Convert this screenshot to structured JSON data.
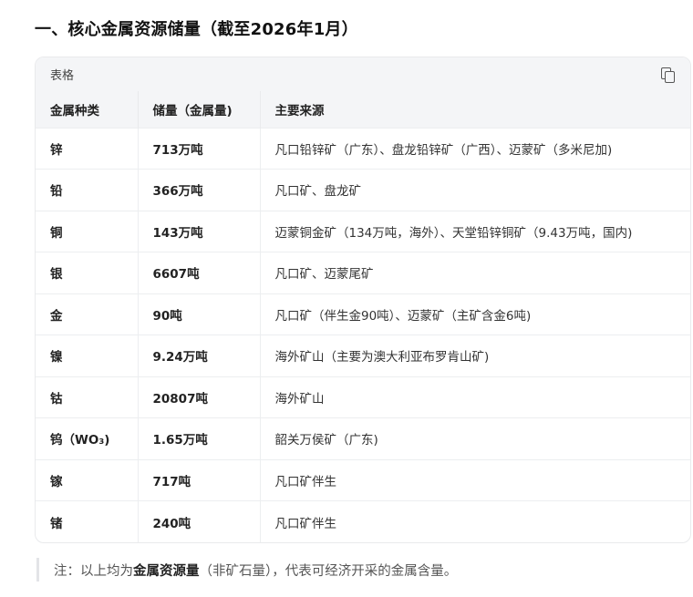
{
  "heading": "一、核心金属资源储量（截至2026年1月）",
  "table_card": {
    "title": "表格",
    "copy_icon": "copy-icon",
    "columns": [
      "金属种类",
      "储量（金属量)",
      "主要来源"
    ],
    "rows": [
      {
        "metal": "锌",
        "reserve": "713万吨",
        "source": "凡口铅锌矿（广东）、盘龙铅锌矿（广西）、迈蒙矿（多米尼加)"
      },
      {
        "metal": "铅",
        "reserve": "366万吨",
        "source": "凡口矿、盘龙矿"
      },
      {
        "metal": "铜",
        "reserve": "143万吨",
        "source": "迈蒙铜金矿（134万吨，海外）、天堂铅锌铜矿（9.43万吨，国内)"
      },
      {
        "metal": "银",
        "reserve": "6607吨",
        "source": "凡口矿、迈蒙尾矿"
      },
      {
        "metal": "金",
        "reserve": "90吨",
        "source": "凡口矿（伴生金90吨）、迈蒙矿（主矿含金6吨)"
      },
      {
        "metal": "镍",
        "reserve": "9.24万吨",
        "source": "海外矿山（主要为澳大利亚布罗肯山矿)"
      },
      {
        "metal": "钴",
        "reserve": "20807吨",
        "source": "海外矿山"
      },
      {
        "metal": "钨（WO₃)",
        "reserve": "1.65万吨",
        "source": "韶关万侯矿（广东)"
      },
      {
        "metal": "镓",
        "reserve": "717吨",
        "source": "凡口矿伴生"
      },
      {
        "metal": "锗",
        "reserve": "240吨",
        "source": "凡口矿伴生"
      }
    ]
  },
  "note": {
    "prefix": "注：以上均为",
    "bold": "金属资源量",
    "suffix": "（非矿石量），代表可经济开采的金属含量。"
  }
}
